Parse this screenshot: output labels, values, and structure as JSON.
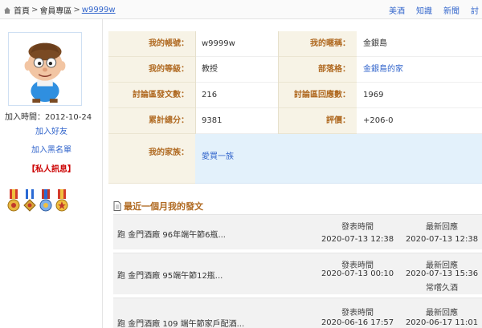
{
  "breadcrumb": {
    "home": "首頁",
    "section": "會員專區",
    "current": "w9999w",
    "separator": ">"
  },
  "topnav": [
    "美酒",
    "知識",
    "新聞",
    "討"
  ],
  "sidebar": {
    "reg_date": "加入時間：2012-10-24",
    "add_friend": "加入好友",
    "add_blacklist": "加入黑名單",
    "private_msg": "【私人訊息】"
  },
  "profile": {
    "account_label": "我的帳號：",
    "account": "w9999w",
    "nickname_label": "我的暱稱：",
    "nickname": "金銀島",
    "level_label": "我的等級：",
    "level": "教授",
    "tribe_label": "部落格：",
    "tribe": "金銀島的家",
    "posts_label": "討論區發文數：",
    "posts": "216",
    "replies_label": "討論區回應數：",
    "replies": "1969",
    "points_label": "累計總分：",
    "points": "9381",
    "rating_label": "評價：",
    "rating": "+206-0",
    "family_label": "我的家族：",
    "family": "愛買一族"
  },
  "recent": {
    "title": "最近一個月我的發文",
    "col_post_time": "發表時間",
    "col_latest_reply": "最新回應",
    "items": [
      {
        "title": "跑 金門酒廠 96年端午節6瓶...",
        "post_time": "2020-07-13 12:38",
        "reply_time": "2020-07-13 12:38",
        "reply_user": ""
      },
      {
        "title": "跑 金門酒廠 95端午節12瓶...",
        "post_time": "2020-07-13 00:10",
        "reply_time": "2020-07-13 15:36",
        "reply_user": "常嚐久酒"
      },
      {
        "title": "跑 金門酒廠 109 端午節家戶配酒...",
        "post_time": "2020-06-16 17:57",
        "reply_time": "2020-06-17 11:01",
        "reply_user": ""
      }
    ]
  },
  "colors": {
    "label_bg": "#f7f3e6",
    "label_text": "#b06a22",
    "link": "#3366cc",
    "family_bg": "#e3f1fb",
    "post_bg": "#f2f2f2"
  }
}
